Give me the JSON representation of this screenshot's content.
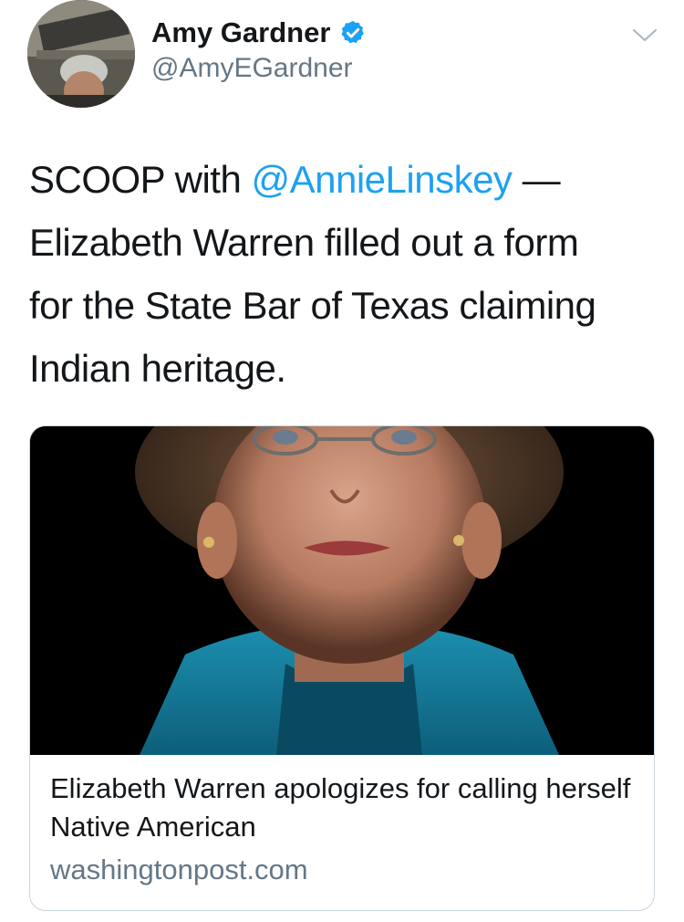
{
  "author": {
    "name": "Amy Gardner",
    "handle": "@AmyEGardner",
    "verified": true,
    "avatar_alt": "profile photo"
  },
  "tweet": {
    "text_lines": {
      "part1": "SCOOP with ",
      "mention": "@AnnieLinskey",
      "part2": " —",
      "line2": "Elizabeth Warren filled out a form",
      "line3": "for the State Bar of Texas claiming",
      "line4": "Indian heritage."
    }
  },
  "card": {
    "title": "Elizabeth Warren apologizes for calling herself Native American",
    "domain": "washingtonpost.com"
  },
  "colors": {
    "link": "#1da1f2",
    "verified": "#1da1f2",
    "secondary_text": "#657786",
    "border": "#ccd6dd"
  },
  "icons": {
    "verified": "verified-badge-icon",
    "menu": "chevron-down-icon"
  }
}
